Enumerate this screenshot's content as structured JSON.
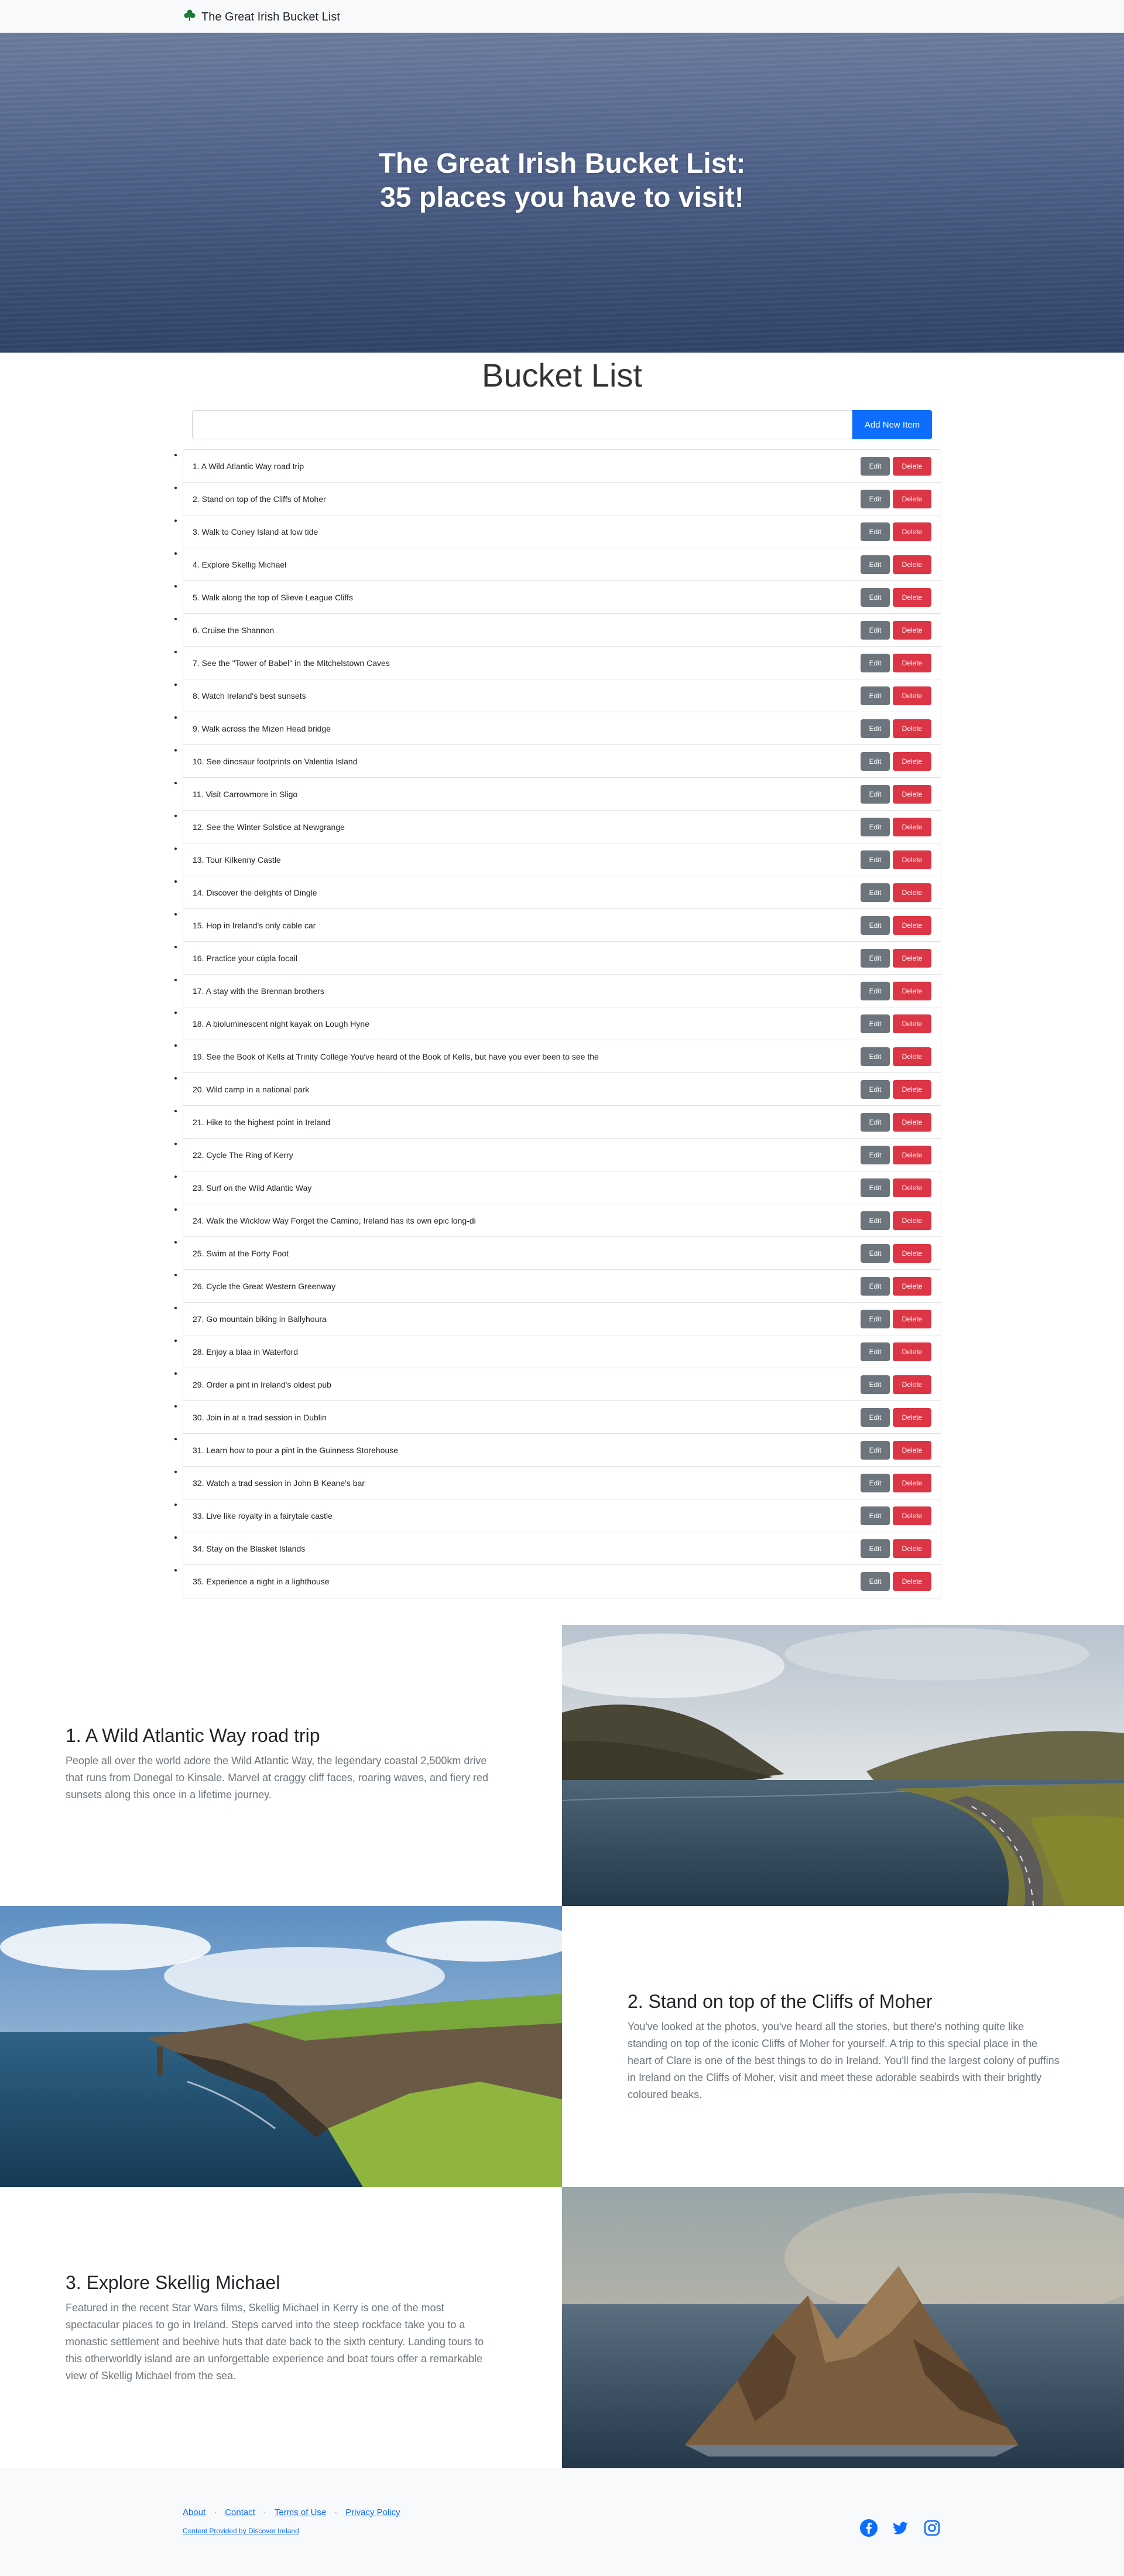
{
  "navbar": {
    "brand": "The Great Irish Bucket List",
    "logo_icon": "shamrock-icon",
    "logo_color": "#1e7b34"
  },
  "hero": {
    "title_line1": "The Great Irish Bucket List:",
    "title_line2": "35 places you have to visit!"
  },
  "bucket_list": {
    "title": "Bucket List",
    "input_value": "",
    "input_placeholder": "",
    "add_button": "Add New Item",
    "edit_label": "Edit",
    "delete_label": "Delete",
    "items": [
      "1. A Wild Atlantic Way road trip",
      "2. Stand on top of the Cliffs of Moher",
      "3. Walk to Coney Island at low tide",
      "4. Explore Skellig Michael",
      "5. Walk along the top of Slieve League Cliffs",
      "6. Cruise the Shannon",
      "7. See the \"Tower of Babel\" in the Mitchelstown Caves",
      "8. Watch Ireland's best sunsets",
      "9. Walk across the Mizen Head bridge",
      "10. See dinosaur footprints on Valentia Island",
      "11. Visit Carrowmore in Sligo",
      "12. See the Winter Solstice at Newgrange",
      "13. Tour Kilkenny Castle",
      "14. Discover the delights of Dingle",
      "15. Hop in Ireland's only cable car",
      "16. Practice your cúpla focail",
      "17. A stay with the Brennan brothers",
      "18. A bioluminescent night kayak on Lough Hyne",
      "19. See the Book of Kells at Trinity College You've heard of the Book of Kells, but have you ever been to see the",
      "20. Wild camp in a national park",
      "21. Hike to the highest point in Ireland",
      "22. Cycle The Ring of Kerry",
      "23. Surf on the Wild Atlantic Way",
      "24. Walk the Wicklow Way Forget the Camino, Ireland has its own epic long-di",
      "25. Swim at the Forty Foot",
      "26. Cycle the Great Western Greenway",
      "27. Go mountain biking in Ballyhoura",
      "28. Enjoy a blaa in Waterford",
      "29. Order a pint in Ireland's oldest pub",
      "30. Join in at a trad session in Dublin",
      "31. Learn how to pour a pint in the Guinness Storehouse",
      "32. Watch a trad session in John B Keane's bar",
      "33. Live like royalty in a fairytale castle",
      "34. Stay on the Blasket Islands",
      "35. Experience a night in a lighthouse"
    ]
  },
  "showcase": [
    {
      "title": "1. A Wild Atlantic Way road trip",
      "description": "People all over the world adore the Wild Atlantic Way, the legendary coastal 2,500km drive that runs from Donegal to Kinsale. Marvel at craggy cliff faces, roaring waves, and fiery red sunsets along this once in a lifetime journey.",
      "image": "coastal-road-photo"
    },
    {
      "title": "2. Stand on top of the Cliffs of Moher",
      "description": "You've looked at the photos, you've heard all the stories, but there's nothing quite like standing on top of the iconic Cliffs of Moher for yourself. A trip to this special place in the heart of Clare is one of the best things to do in Ireland. You'll find the largest colony of puffins in Ireland on the Cliffs of Moher, visit and meet these adorable seabirds with their brightly coloured beaks.",
      "image": "cliffs-photo"
    },
    {
      "title": "3. Explore Skellig Michael",
      "description": "Featured in the recent Star Wars films, Skellig Michael in Kerry is one of the most spectacular places to go in Ireland. Steps carved into the steep rockface take you to a monastic settlement and beehive huts that date back to the sixth century. Landing tours to this otherworldly island are an unforgettable experience and boat tours offer a remarkable view of Skellig Michael from the sea.",
      "image": "island-photo"
    }
  ],
  "footer": {
    "links": [
      "About",
      "Contact",
      "Terms of Use",
      "Privacy Policy"
    ],
    "separator": "·",
    "credit": "Content Provided by Discover Ireland",
    "social": [
      "facebook-icon",
      "twitter-icon",
      "instagram-icon"
    ],
    "link_color": "#0d6efd"
  }
}
